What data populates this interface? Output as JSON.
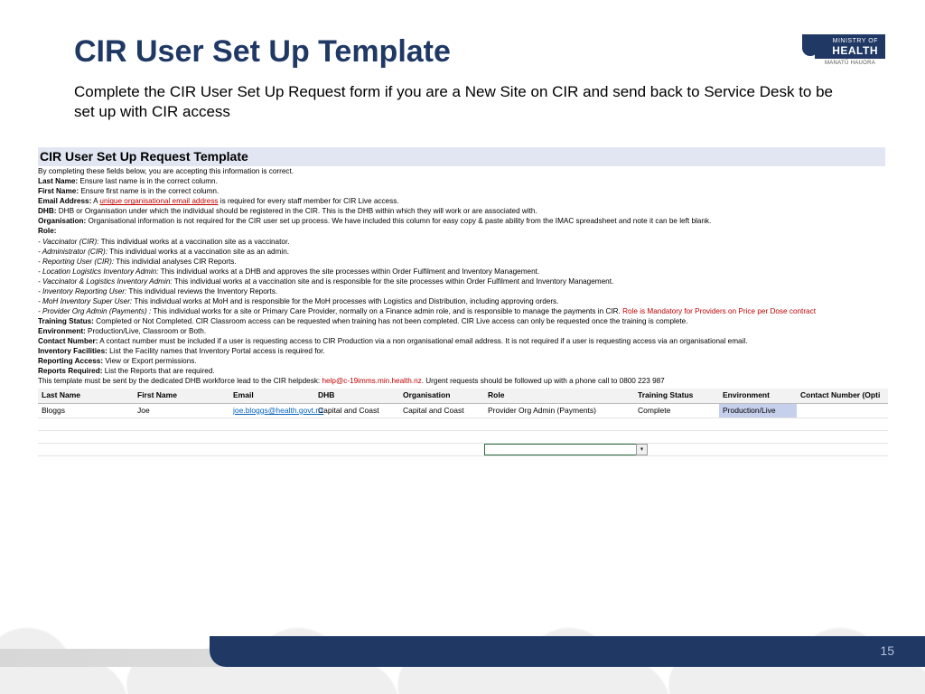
{
  "header": {
    "title": "CIR User Set Up Template",
    "logo_line1": "MINISTRY OF",
    "logo_line2": "HEALTH",
    "logo_sub": "MANATŪ HAUORA"
  },
  "description": "Complete the CIR User Set Up Request form if you are a New Site on CIR and send back to Service Desk to be set up with CIR access",
  "form": {
    "title": "CIR User Set Up Request Template",
    "intro": "By completing these fields below, you are accepting this information is correct.",
    "last_name_lbl": "Last Name:",
    "last_name_txt": " Ensure last name is in the correct column.",
    "first_name_lbl": "First Name:",
    "first_name_txt": " Ensure first name is in the correct column.",
    "email_lbl": "Email Address:",
    "email_txt_a": " A ",
    "email_link": "unique organisational email address",
    "email_txt_b": " is required for every staff member for CIR Live access.",
    "dhb_lbl": "DHB:",
    "dhb_txt": " DHB or Organisation under which the individual should be registered in the CIR. This is the DHB within which they will work or are associated with.",
    "org_lbl": "Organisation:",
    "org_txt": " Organisational information is not required for the CIR user set up process. We have included this column for easy copy & paste ability from the IMAC spreadsheet and note it can be left blank.",
    "role_lbl": "Role:",
    "role_vacc_i": "- Vaccinator (CIR):",
    "role_vacc_t": "  This individual works at a vaccination site as a vaccinator.",
    "role_admin_i": "- Administrator (CIR):",
    "role_admin_t": " This individual works at a vaccination site as an admin.",
    "role_rep_i": "- Reporting User (CIR):",
    "role_rep_t": "  This individial analyses CIR Reports.",
    "role_loc_i": "- Location Logistics Inventory Admin:",
    "role_loc_t": "  This individual works at a DHB and approves the site processes within Order Fulfilment and Inventory Management.",
    "role_vl_i": "- Vaccinator & Logistics Inventory Admin:",
    "role_vl_t": " This individual works at a vaccination site and is responsible for the site processes within Order Fulfilment and Inventory Management.",
    "role_inv_i": "- Inventory Reporting User:",
    "role_inv_t": "  This individual reviews the Inventory Reports.",
    "role_moh_i": "- MoH Inventory Super User:",
    "role_moh_t": "  This individual works at MoH and is responsible for the MoH processes with Logistics and Distribution, including approving orders.",
    "role_prov_i": "- Provider Org Admin (Payments) :",
    "role_prov_t": " This individual works for a site or Primary Care Provider, normally on a Finance admin role, and is responsible to manage the payments in CIR.  ",
    "role_prov_red": "Role is Mandatory for Providers on Price per Dose contract",
    "train_lbl": "Training Status:",
    "train_txt": " Completed or Not Completed. CIR Classroom access can be requested when training has not been completed.  CIR Live access can only be requested once the training is complete.",
    "env_lbl": "Environment:",
    "env_txt": " Production/Live, Classroom or Both.",
    "contact_lbl": "Contact Number:",
    "contact_txt": " A contact number must be included if a user is requesting access to CIR Production via a non organisational email address.  It is not required if a user is requesting access via an organisational email.",
    "invfac_lbl": "Inventory Facilities:",
    "invfac_txt": " List the Facility names that Inventory Portal access is required for.",
    "repacc_lbl": "Reporting Access:",
    "repacc_txt": " View or Export permissions.",
    "repreq_lbl": "Reports Required:",
    "repreq_txt": " List the Reports that are required.",
    "sendnote_a": "This template must be sent by the dedicated DHB workforce lead to the CIR helpdesk: ",
    "sendnote_link": "help@c-19imms.min.health.nz",
    "sendnote_b": ".   Urgent requests should be followed up with a phone call to 0800 223 987"
  },
  "table": {
    "headers": [
      "Last Name",
      "First Name",
      "Email",
      "DHB",
      "Organisation",
      "Role",
      "Training Status",
      "Environment",
      "Contact Number (Opti"
    ],
    "row": {
      "last": "Bloggs",
      "first": "Joe",
      "email": "joe.bloggs@health.govt.nz",
      "dhb": "Capital and Coast",
      "org": "Capital and Coast",
      "role": "Provider Org Admin (Payments)",
      "training": "Complete",
      "env": "Production/Live",
      "contact": ""
    }
  },
  "page_number": "15"
}
